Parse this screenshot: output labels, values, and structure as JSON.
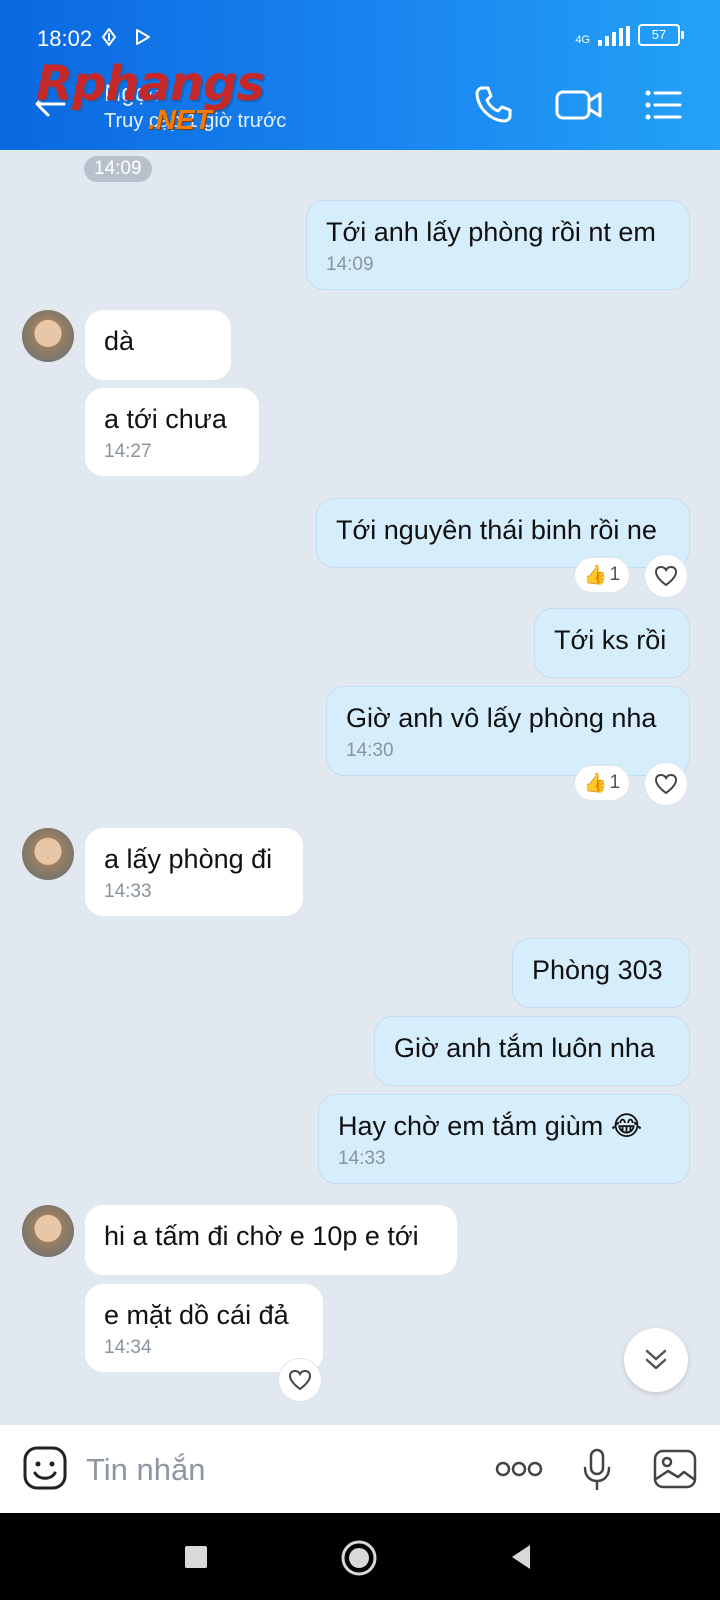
{
  "status_bar": {
    "time": "18:02",
    "network": "4G",
    "battery": "57"
  },
  "header": {
    "contact_name": "Ngọc",
    "contact_status": "Truy cập 1 giờ trước",
    "watermark_main": "Rphangs",
    "watermark_sub": ".NET"
  },
  "chat": {
    "time_divider": "14:09",
    "messages": [
      {
        "sender": "me",
        "text": "Tới anh lấy phòng rồi nt em",
        "time": "14:09"
      },
      {
        "sender": "them",
        "text": "dà"
      },
      {
        "sender": "them",
        "text": "a tới  chưa",
        "time": "14:27"
      },
      {
        "sender": "me",
        "text": "Tới nguyên thái binh rồi ne",
        "reaction": "👍",
        "reaction_count": "1"
      },
      {
        "sender": "me",
        "text": "Tới ks rồi"
      },
      {
        "sender": "me",
        "text": "Giờ anh vô lấy phòng nha",
        "time": "14:30",
        "reaction": "👍",
        "reaction_count": "1"
      },
      {
        "sender": "them",
        "text": "a lấy phòng đi",
        "time": "14:33"
      },
      {
        "sender": "me",
        "text": "Phòng 303"
      },
      {
        "sender": "me",
        "text": "Giờ anh tắm luôn nha"
      },
      {
        "sender": "me",
        "text": "Hay chờ em tắm giùm",
        "emoji": "😂",
        "time": "14:33"
      },
      {
        "sender": "them",
        "text": "hi a tấm đi chờ e 10p e tới"
      },
      {
        "sender": "them",
        "text": "e mặt dồ cái đả",
        "time": "14:34"
      }
    ]
  },
  "input_bar": {
    "placeholder": "Tin nhắn"
  },
  "colors": {
    "header_start": "#0a68e0",
    "header_end": "#23a2f7",
    "my_bubble": "#d6edfc",
    "their_bubble": "#ffffff",
    "background": "#e2e8ef"
  }
}
